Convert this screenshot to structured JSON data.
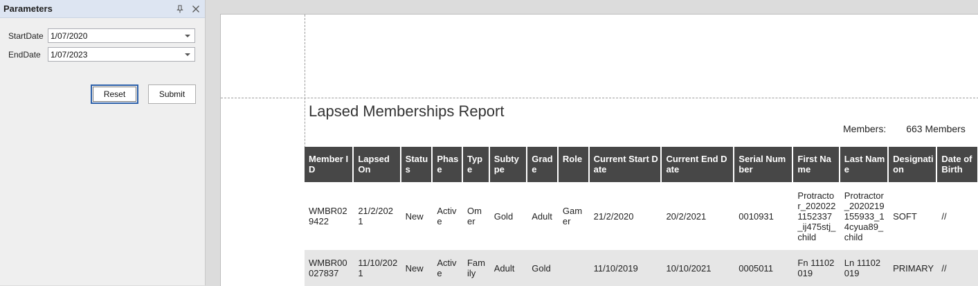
{
  "panel": {
    "title": "Parameters",
    "params": [
      {
        "label": "StartDate",
        "value": "1/07/2020"
      },
      {
        "label": "EndDate",
        "value": "1/07/2023"
      }
    ],
    "reset_label": "Reset",
    "submit_label": "Submit"
  },
  "report": {
    "title": "Lapsed Memberships Report",
    "members_label": "Members:",
    "members_value": "663 Members",
    "columns": [
      "Member ID",
      "Lapsed On",
      "Status",
      "Phase",
      "Type",
      "Subtype",
      "Grade",
      "Role",
      "Current Start Date",
      "Current End Date",
      "Serial Number",
      "First Name",
      "Last Name",
      "Designation",
      "Date of Birth"
    ],
    "rows": [
      [
        "WMBR029422",
        "21/2/2021",
        "New",
        "Active",
        "Omer",
        "Gold",
        "Adult",
        "Gamer",
        "21/2/2020",
        "20/2/2021",
        "0010931",
        "Protractor_2020221152337_ij475stj_child",
        "Protractor_2020219155933_14cyua89_child",
        "SOFT",
        "//"
      ],
      [
        "WMBR00027837",
        "11/10/2021",
        "New",
        "Active",
        "Family",
        "Adult",
        "Gold",
        "",
        "11/10/2019",
        "10/10/2021",
        "0005011",
        "Fn 11102019",
        "Ln 11102019",
        "PRIMARY",
        "//"
      ]
    ]
  },
  "icons": {
    "pin": "pin-icon",
    "close": "close-icon",
    "dropdown": "chevron-down-icon"
  }
}
